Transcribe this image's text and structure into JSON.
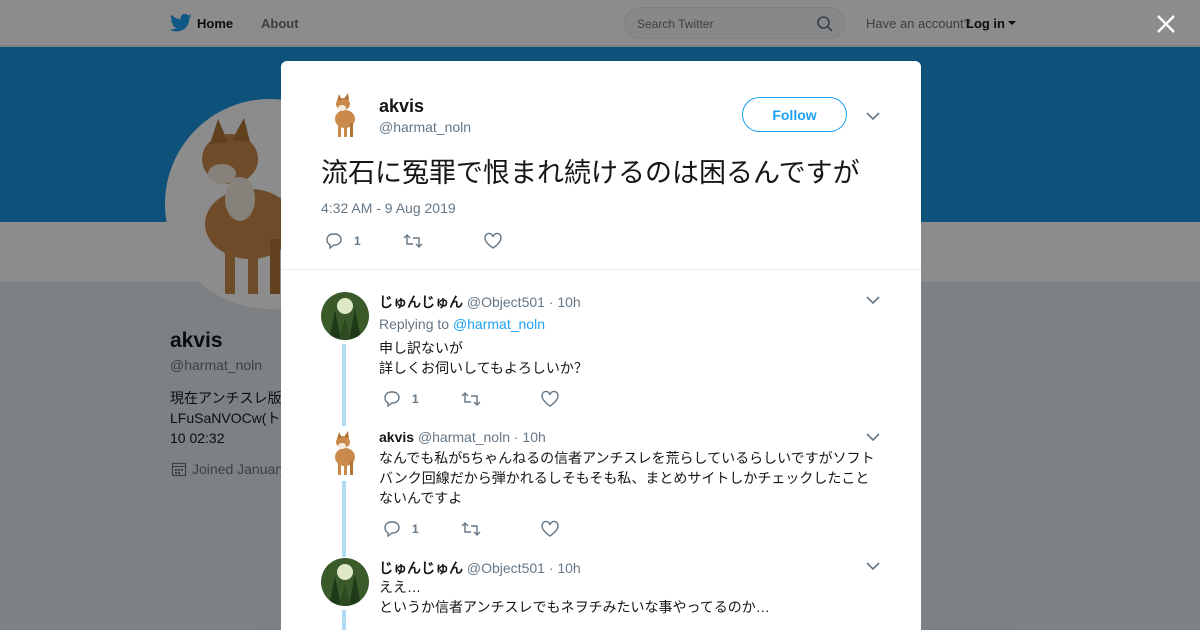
{
  "nav": {
    "home": "Home",
    "about": "About",
    "search_placeholder": "Search Twitter",
    "account_text": "Have an account?",
    "login": "Log in"
  },
  "profile": {
    "name": "akvis",
    "handle": "@harmat_noln",
    "bio": "現在アンチスレ版\nLFuSaNVOCw(ト\n10 02:32",
    "joined": "Joined January"
  },
  "tweet": {
    "name": "akvis",
    "handle": "@harmat_noln",
    "follow": "Follow",
    "text": "流石に冤罪で恨まれ続けるのは困るんですが",
    "time": "4:32 AM - 9 Aug 2019",
    "reply_count": "1"
  },
  "replies": [
    {
      "name": "じゅんじゅん",
      "meta": "@Object501 · 10h",
      "replying_prefix": "Replying to",
      "replying_to": "@harmat_noln",
      "text": "申し訳ないが\n詳しくお伺いしてもよろしいか？",
      "reply_count": "1"
    },
    {
      "name": "akvis",
      "meta": "@harmat_noln · 10h",
      "text": "なんでも私が5ちゃんねるの信者アンチスレを荒らしているらしいですがソフトバンク回線だから弾かれるしそもそも私、まとめサイトしかチェックしたことないんですよ",
      "reply_count": "1"
    },
    {
      "name": "じゅんじゅん",
      "meta": "@Object501 · 10h",
      "text": "ええ…\nというか信者アンチスレでもネヲチみたいな事やってるのか…"
    }
  ],
  "colors": {
    "brand": "#1da1f2",
    "banner": "#1b95e0",
    "thread": "#b1dcf6"
  }
}
